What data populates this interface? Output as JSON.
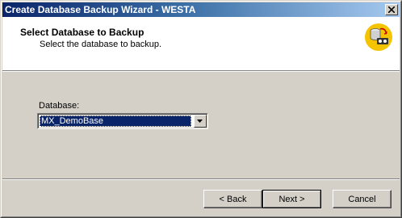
{
  "window": {
    "title": "Create Database Backup Wizard - WESTA"
  },
  "header": {
    "title": "Select Database to Backup",
    "subtitle": "Select the database to backup.",
    "icon": "database-backup-icon"
  },
  "form": {
    "database_label": "Database:",
    "database_value": "MX_DemoBase"
  },
  "buttons": {
    "back": "< Back",
    "next": "Next >",
    "cancel": "Cancel"
  },
  "colors": {
    "title_bar_start": "#0a246a",
    "title_bar_end": "#a6caf0",
    "selection": "#0a246a",
    "face": "#d4d0c8",
    "icon_yellow": "#f5c400"
  }
}
